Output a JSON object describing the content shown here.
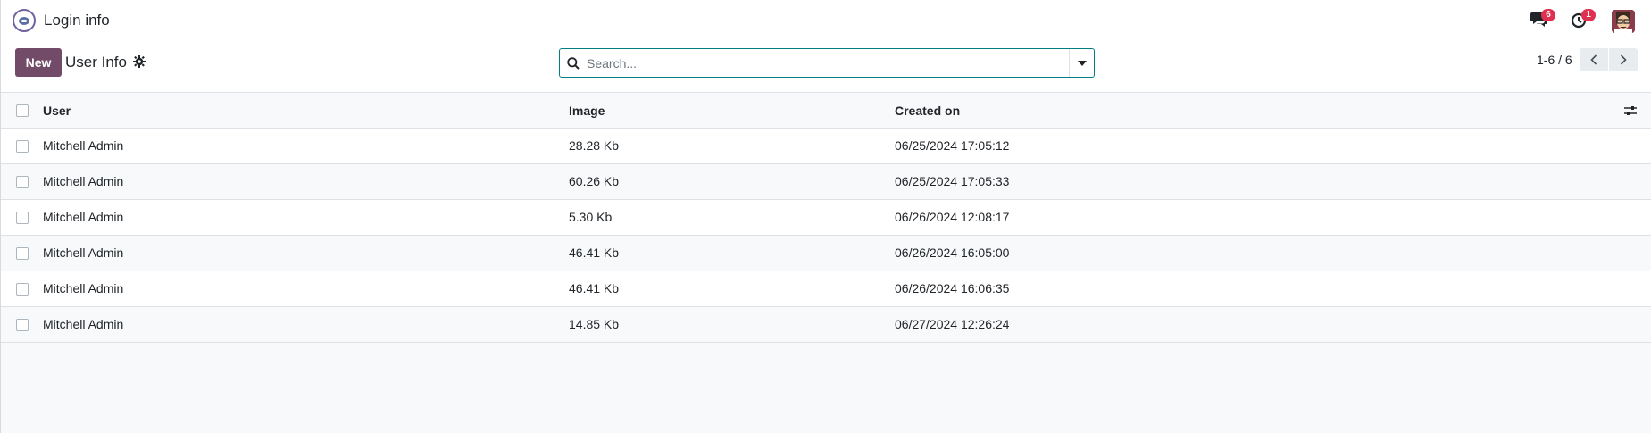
{
  "app": {
    "title": "Login info",
    "messages_badge": "6",
    "activities_badge": "1"
  },
  "control_panel": {
    "new_label": "New",
    "breadcrumb": "User Info",
    "search_placeholder": "Search...",
    "pager_value": "1-6 / 6"
  },
  "table": {
    "columns": {
      "user": "User",
      "image": "Image",
      "created_on": "Created on"
    },
    "rows": [
      {
        "user": "Mitchell Admin",
        "image": "28.28 Kb",
        "created_on": "06/25/2024 17:05:12"
      },
      {
        "user": "Mitchell Admin",
        "image": "60.26 Kb",
        "created_on": "06/25/2024 17:05:33"
      },
      {
        "user": "Mitchell Admin",
        "image": "5.30 Kb",
        "created_on": "06/26/2024 12:08:17"
      },
      {
        "user": "Mitchell Admin",
        "image": "46.41 Kb",
        "created_on": "06/26/2024 16:05:00"
      },
      {
        "user": "Mitchell Admin",
        "image": "46.41 Kb",
        "created_on": "06/26/2024 16:06:35"
      },
      {
        "user": "Mitchell Admin",
        "image": "14.85 Kb",
        "created_on": "06/27/2024 12:26:24"
      }
    ]
  },
  "colors": {
    "primary": "#714b67",
    "accent": "#017e84",
    "badge": "#e0304f"
  },
  "icons": [
    "app-icon",
    "messages-icon",
    "activities-icon",
    "gear-icon",
    "search-icon",
    "caret-down-icon",
    "chevron-left-icon",
    "chevron-right-icon",
    "optional-columns-icon"
  ]
}
